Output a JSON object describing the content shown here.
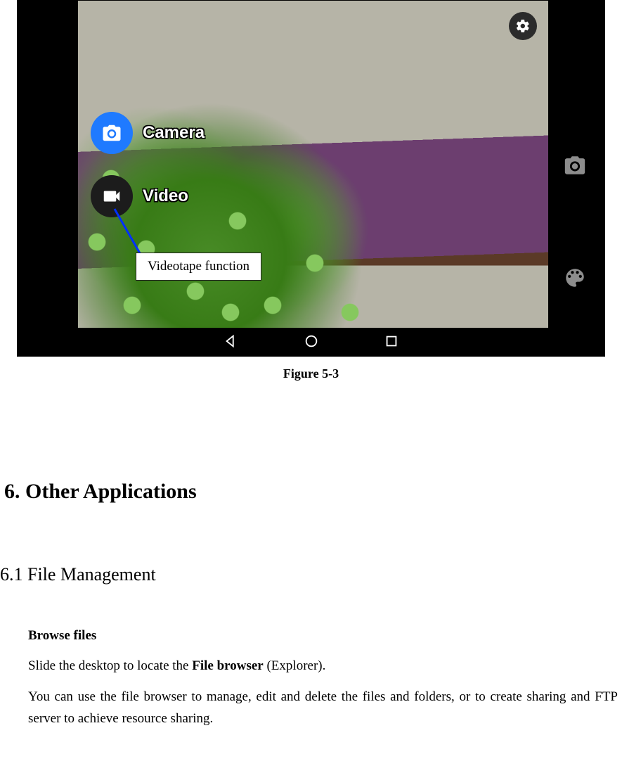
{
  "figure_caption": "Figure 5-3",
  "screenshot": {
    "gear_button": "Settings",
    "camera_label": "Camera",
    "video_label": "Video",
    "callout_text": "Videotape function",
    "side_camera_icon": "Capture",
    "side_filters_icon": "Filters",
    "nav_back": "Back",
    "nav_home": "Home",
    "nav_recents": "Recents"
  },
  "doc": {
    "section_heading": "6. Other Applications",
    "subsection_heading": "6.1 File Management",
    "browse_title": "Browse files",
    "para1_pre": "Slide the desktop to locate the ",
    "para1_bold": "File browser",
    "para1_post": " (Explorer).",
    "para2": "You can use the file browser to manage, edit and delete the files and folders, or to create sharing and FTP server to achieve resource sharing."
  }
}
